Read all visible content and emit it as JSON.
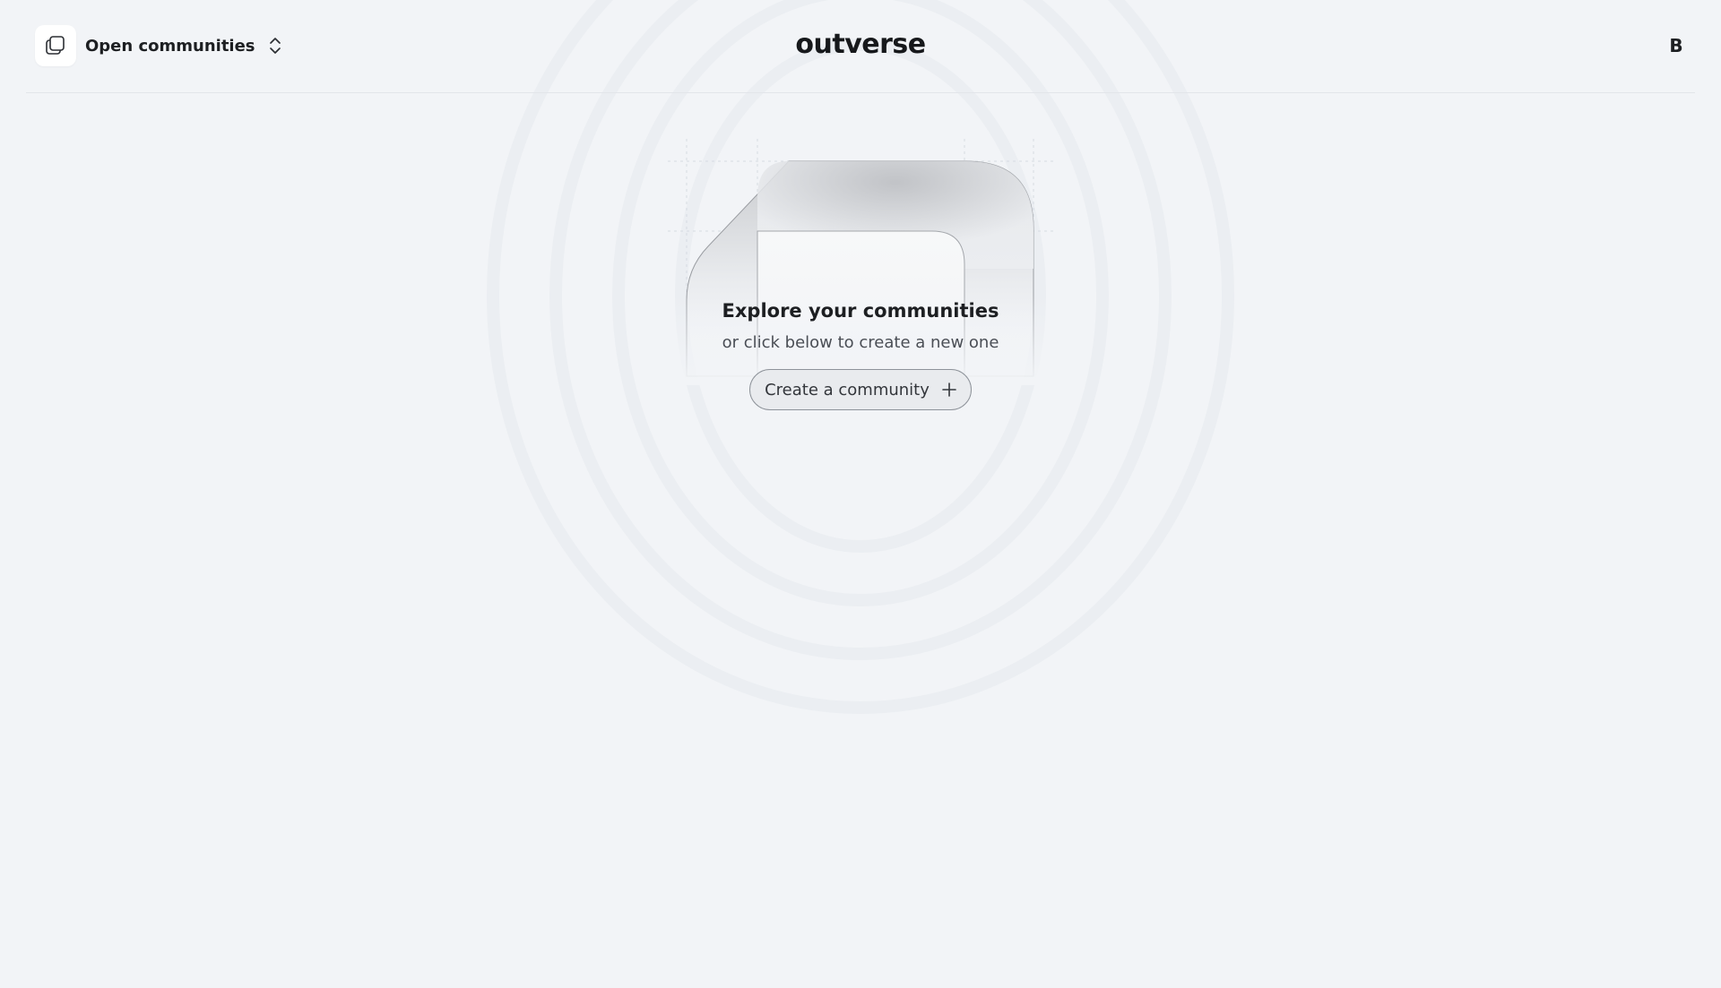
{
  "header": {
    "switcher_label": "Open communities",
    "switcher_icon": "stacked-squares-icon",
    "chevron_icon": "chevron-up-down-icon",
    "brand": "outverse",
    "avatar_initial": "B"
  },
  "empty_state": {
    "title": "Explore your communities",
    "subtitle": "or click below to create a new one",
    "create_button_label": "Create a community",
    "create_button_icon": "plus-icon",
    "illustration": "folded-shape-illustration"
  },
  "colors": {
    "background": "#f2f4f7",
    "text": "#1d1f22",
    "button_border": "#8e939a"
  }
}
